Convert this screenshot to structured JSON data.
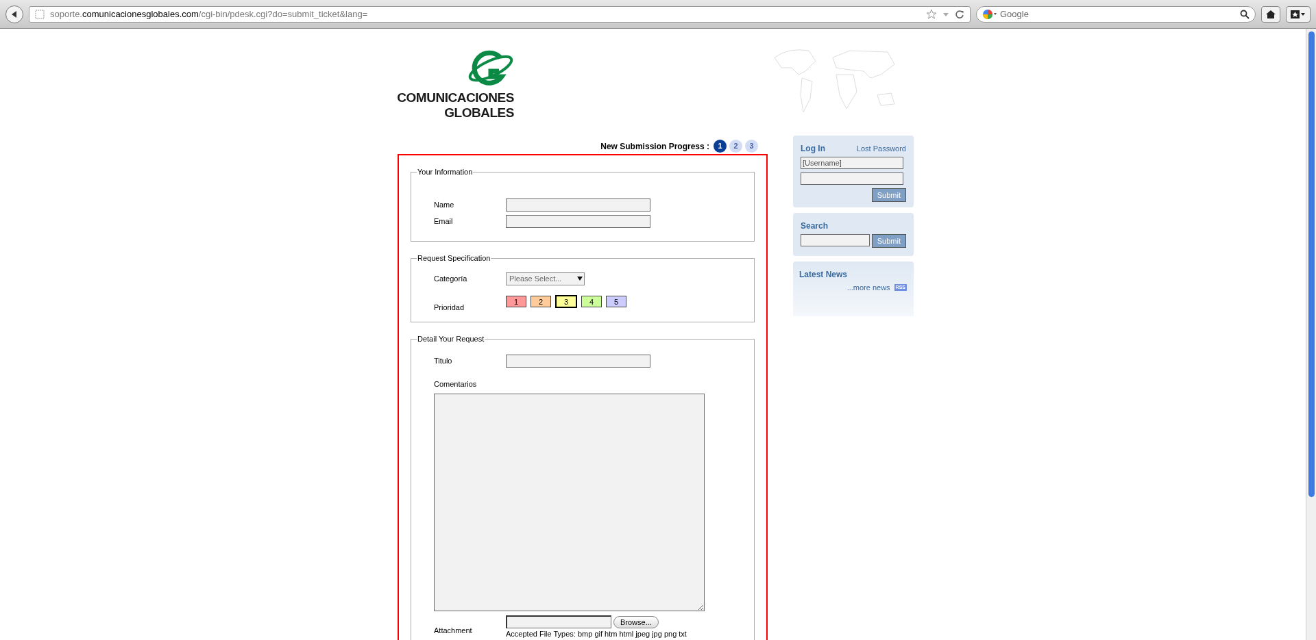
{
  "browser": {
    "url": "soporte.**comunicacionesglobales.com**/cgi-bin/pdesk.cgi?do=submit_ticket&lang=",
    "search_placeholder": "Google"
  },
  "logo": {
    "line_1": "COMUNICACIONES",
    "line_2": "GLOBALES"
  },
  "progress": {
    "label": "New Submission Progress :",
    "steps": [
      {
        "label": "1",
        "selected": true
      },
      {
        "label": "2",
        "selected": false
      },
      {
        "label": "3",
        "selected": false
      }
    ]
  },
  "sections": [
    {
      "legend": "Your Information",
      "fields": [
        {
          "kind": "text",
          "label": "Name"
        },
        {
          "kind": "text",
          "label": "Email"
        }
      ]
    },
    {
      "legend": "Request Specification",
      "fields": [
        {
          "kind": "select",
          "label": "Categoría",
          "placeholder": "Please Select..."
        },
        {
          "kind": "priority",
          "label": "Prioridad",
          "options": [
            {
              "label": "1",
              "color": "#ff9999",
              "selected": false
            },
            {
              "label": "2",
              "color": "#ffcc99",
              "selected": false
            },
            {
              "label": "3",
              "color": "#ffff99",
              "selected": true
            },
            {
              "label": "4",
              "color": "#ccff99",
              "selected": false
            },
            {
              "label": "5",
              "color": "#ccccff",
              "selected": false
            }
          ]
        }
      ]
    },
    {
      "legend": "Detail Your Request",
      "fields": [
        {
          "kind": "text",
          "label": "Titulo"
        },
        {
          "kind": "textarea",
          "label": "Comentarios"
        },
        {
          "kind": "file",
          "label": "Attachment",
          "button": "Browse...",
          "note": "Accepted File Types: bmp gif htm html jpeg jpg png txt"
        }
      ]
    }
  ],
  "sidebar": {
    "login": {
      "title": "Log In",
      "link": "Lost Password",
      "username_placeholder": "[Username]",
      "button": "Submit"
    },
    "search": {
      "title": "Search",
      "button": "Submit"
    },
    "news": {
      "title": "Latest News",
      "link": "...more news",
      "badge": "RSS"
    }
  }
}
